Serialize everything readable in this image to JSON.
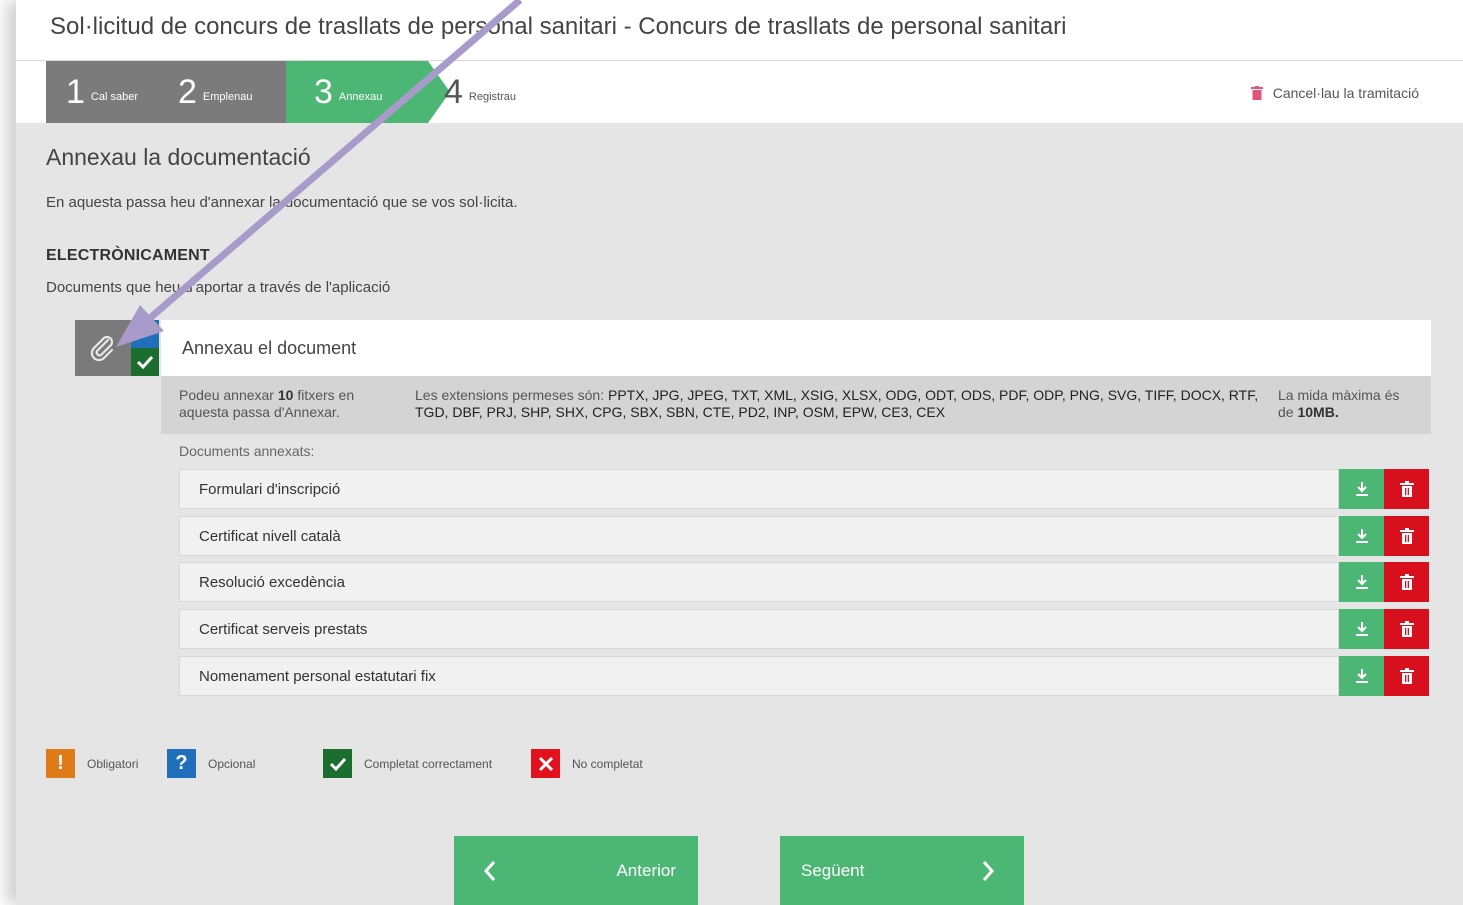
{
  "window": {
    "title": "Sol·licitud de concurs de trasllats de personal sanitari - Concurs de trasllats de personal sanitari"
  },
  "steps": [
    {
      "num": "1",
      "label": "Cal saber"
    },
    {
      "num": "2",
      "label": "Emplenau"
    },
    {
      "num": "3",
      "label": "Annexau"
    },
    {
      "num": "4",
      "label": "Registrau"
    }
  ],
  "cancel_label": "Cancel·lau la tramitació",
  "section": {
    "title": "Annexau la documentació",
    "intro": "En aquesta passa heu d'annexar la documentació que se vos sol·licita.",
    "electronic_heading": "ELECTRÒNICAMENT",
    "electronic_sub": "Documents que heu d'aportar a través de l'aplicació"
  },
  "document": {
    "header": "Annexau el document",
    "files_text_pre": "Podeu annexar",
    "files_count": "10",
    "files_text_post": "fitxers en aquesta passa d'Annexar.",
    "extensions_pre": "Les extensions permeses són:",
    "extensions": "PPTX, JPG, JPEG, TXT, XML, XSIG, XLSX, ODG, ODT, ODS, PDF, ODP, PNG, SVG, TIFF, DOCX, RTF, TGD, DBF, PRJ, SHP, SHX, CPG, SBX, SBN, CTE, PD2, INP, OSM, EPW, CE3, CEX",
    "maxsize_pre": "La mida màxima és de",
    "maxsize": "10MB.",
    "annexed_label": "Documents annexats:",
    "files": [
      "Formulari d'inscripció",
      "Certificat nivell català",
      "Resolució excedència",
      "Certificat serveis prestats",
      "Nomenament personal estatutari fix"
    ]
  },
  "legend": [
    {
      "symbol": "!",
      "label": "Obligatori",
      "color": "#e07b1a"
    },
    {
      "symbol": "?",
      "label": "Opcional",
      "color": "#1f6fba"
    },
    {
      "symbol": "check",
      "label": "Completat correctament",
      "color": "#1c6e2f"
    },
    {
      "symbol": "x",
      "label": "No completat",
      "color": "#e1111d"
    }
  ],
  "nav": {
    "prev": "Anterior",
    "next": "Següent"
  },
  "colors": {
    "accent_green": "#4cb774",
    "delete_red": "#d8101e",
    "annotation_arrow": "#a99bc9"
  }
}
